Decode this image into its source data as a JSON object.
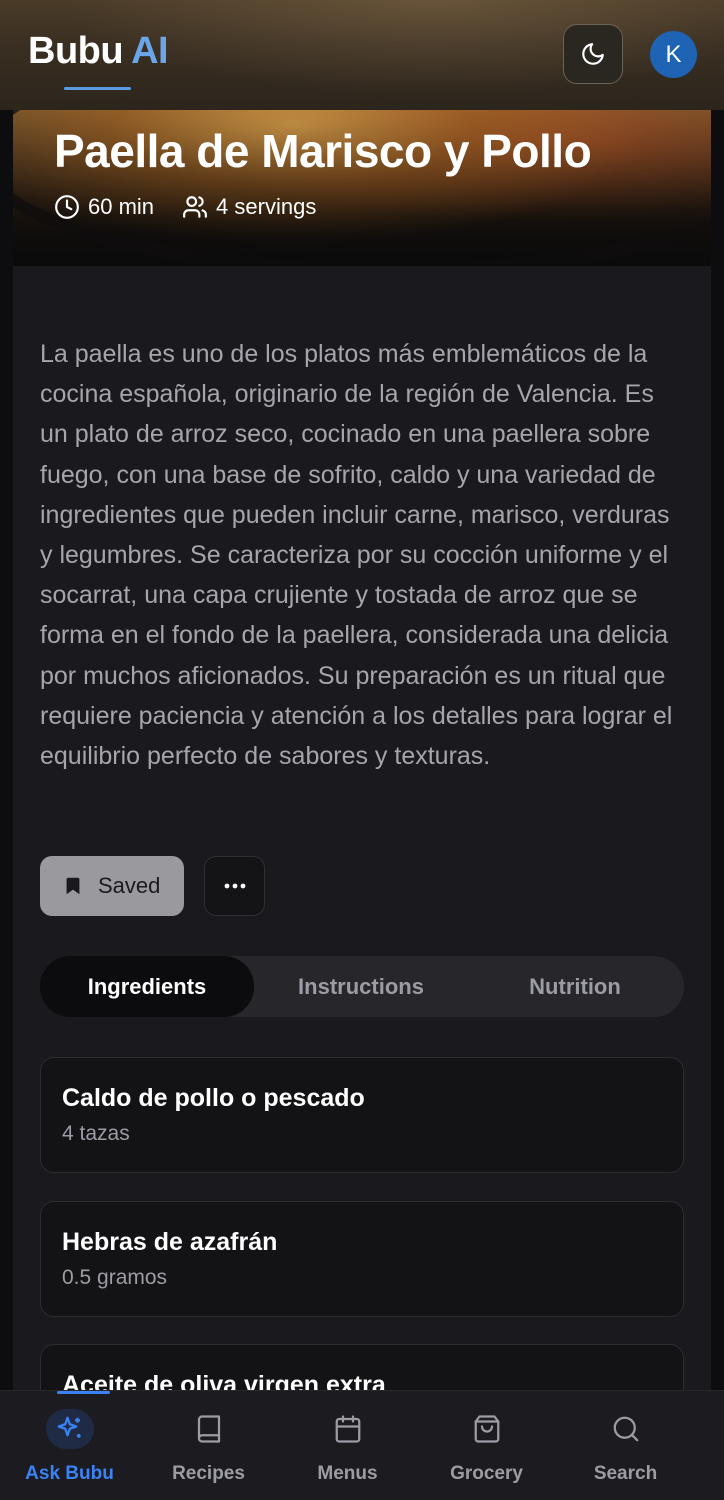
{
  "header": {
    "brand_main": "Bubu",
    "brand_accent": "AI",
    "avatar_initial": "K"
  },
  "recipe": {
    "title": "Paella de Marisco y Pollo",
    "time": "60 min",
    "servings": "4 servings",
    "description": "La paella es uno de los platos más emblemáticos de la cocina española, originario de la región de Valencia. Es un plato de arroz seco, cocinado en una paellera sobre fuego, con una base de sofrito, caldo y una variedad de ingredientes que pueden incluir carne, marisco, verduras y legumbres. Se caracteriza por su cocción uniforme y el socarrat, una capa crujiente y tostada de arroz que se forma en el fondo de la paellera, considerada una delicia por muchos aficionados. Su preparación es un ritual que requiere paciencia y atención a los detalles para lograr el equilibrio perfecto de sabores y texturas."
  },
  "actions": {
    "saved_label": "Saved"
  },
  "tabs": [
    {
      "label": "Ingredients",
      "active": true
    },
    {
      "label": "Instructions",
      "active": false
    },
    {
      "label": "Nutrition",
      "active": false
    }
  ],
  "ingredients": [
    {
      "name": "Caldo de pollo o pescado",
      "qty": "4 tazas"
    },
    {
      "name": "Hebras de azafrán",
      "qty": "0.5 gramos"
    },
    {
      "name": "Aceite de oliva virgen extra",
      "qty": ""
    }
  ],
  "bottom_nav": [
    {
      "label": "Ask Bubu",
      "icon": "sparkles-icon",
      "active": true
    },
    {
      "label": "Recipes",
      "icon": "book-icon",
      "active": false
    },
    {
      "label": "Menus",
      "icon": "calendar-icon",
      "active": false
    },
    {
      "label": "Grocery",
      "icon": "shopping-bag-icon",
      "active": false
    },
    {
      "label": "Search",
      "icon": "search-icon",
      "active": false
    }
  ],
  "colors": {
    "accent": "#3b82f6",
    "brand_ai": "#6aa5ea",
    "avatar_bg": "#1f63b5"
  }
}
